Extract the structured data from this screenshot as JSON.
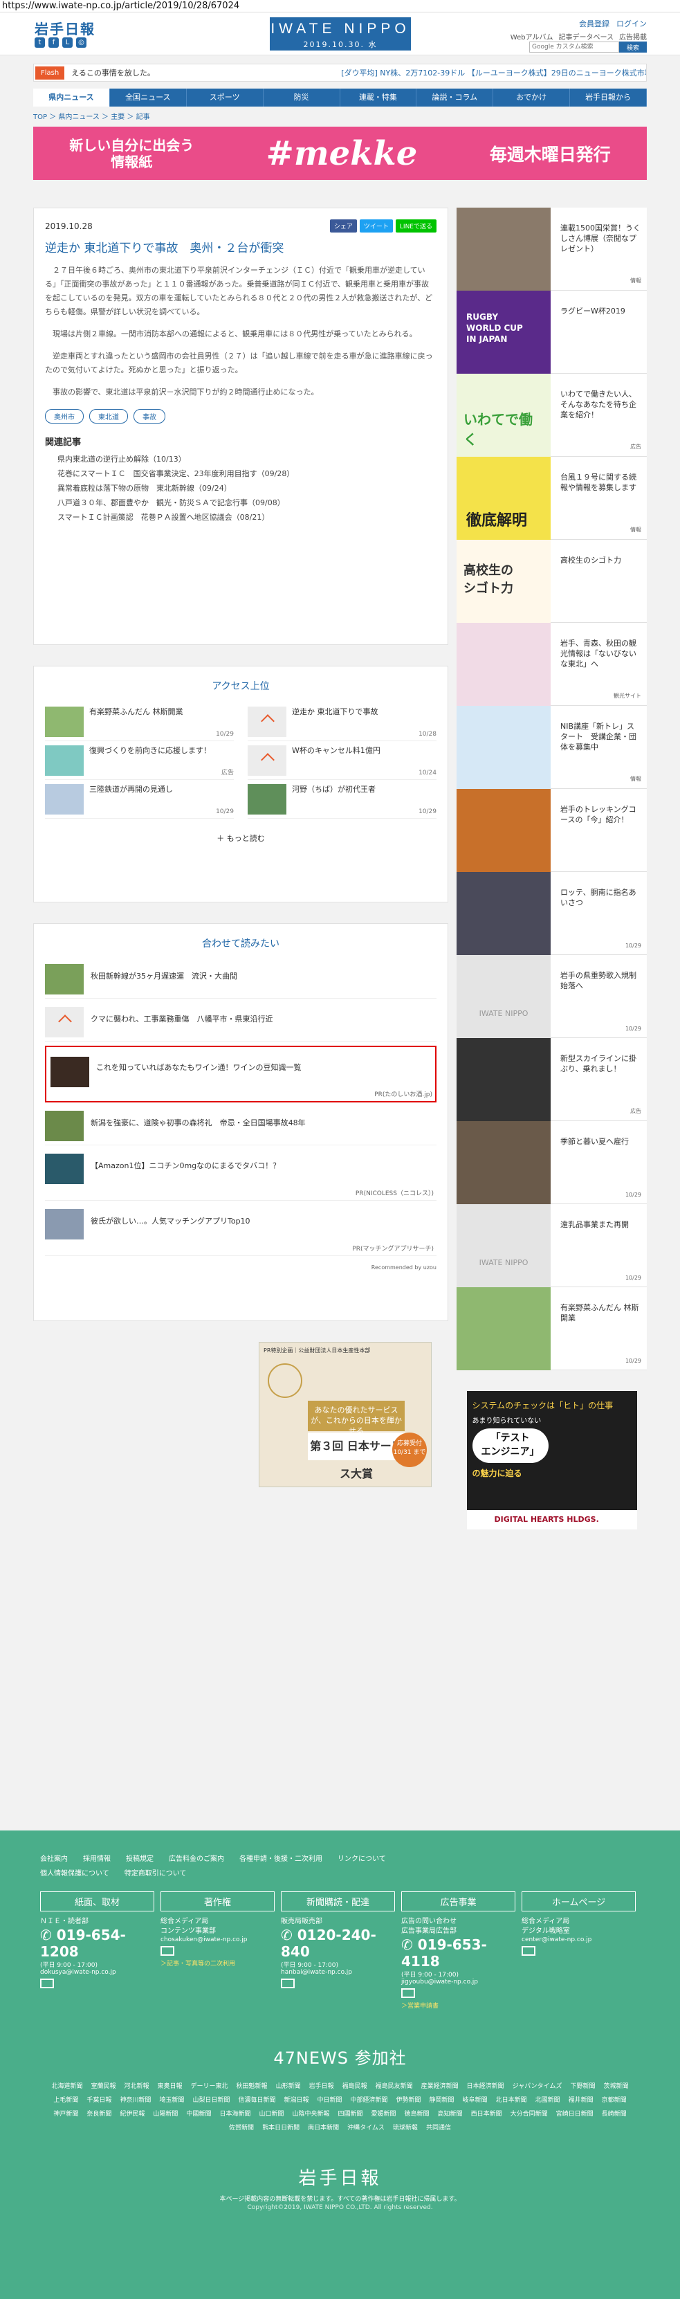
{
  "url": "https://www.iwate-np.co.jp/article/2019/10/28/67024",
  "header": {
    "logo_text": "岩手日報",
    "brand": "IWATE NIPPO",
    "date": "2019.10.30. 水",
    "links": [
      "会員登録",
      "ログイン"
    ],
    "sublinks": [
      "Webアルバム",
      "記事データベース",
      "広告掲載"
    ],
    "search_placeholder": "Google カスタム検索",
    "search_button": "検索",
    "social_icons": [
      "twitter-icon",
      "facebook-icon",
      "line-icon",
      "instagram-icon"
    ]
  },
  "ticker": {
    "label": "Flash",
    "text": "えるこの事情を放した。",
    "market": "[ダウ平均] NY株、2万7102-39ドル  【ルーユーヨーク株式】29日のニューヨーク株式市場のダウ工業株30種"
  },
  "nav": [
    "県内ニュース",
    "全国ニュース",
    "スポーツ",
    "防災",
    "連載・特集",
    "論説・コラム",
    "おでかけ",
    "岩手日報から"
  ],
  "breadcrumb": "TOP ＞ 県内ニュース ＞ 主要 ＞ 記事",
  "banner": {
    "left": "新しい自分に出会う\n情報紙",
    "middle": "#mekke",
    "right": "毎週木曜日発行"
  },
  "article": {
    "date": "2019.10.28",
    "share": [
      "シェア",
      "ツイート",
      "LINEで送る"
    ],
    "title": "逆走か 東北道下りで事故　奥州・２台が衝突",
    "paragraphs": [
      "２７日午後６時ごろ、奥州市の東北道下り平泉前沢インターチェンジ（ＩＣ）付近で「観乗用車が逆走している」「正面衝突の事故があった」と１１０番通報があった。乗普乗道路が同ＩＣ付近で、観乗用車と乗用車が事故を起こしているのを発見。双方の車を運転していたとみられる８０代と２０代の男性２人が救急搬送されたが、どちらも軽傷。県警が詳しい状況を調べている。",
      "現場は片側２車線。一関市消防本部への通報によると、観乗用車には８０代男性が乗っていたとみられる。",
      "逆走車両とすれ違ったという盛岡市の会社員男性（２７）は「追い越し車線で前を走る車が急に進路車線に戻ったので気付いてよけた。死ぬかと思った」と振り返った。",
      "事故の影響で、東北道は平泉前沢－水沢間下りが約２時間通行止めになった。"
    ],
    "tags": [
      "奥州市",
      "東北道",
      "事故"
    ],
    "related_heading": "関連記事",
    "related": [
      "県内東北道の逆行止め解除（10/13）",
      "花巻にスマートＩＣ　国交省事業決定、23年度利用目指す（09/28）",
      "異常着底粒は落下物の原物　東北新幹線（09/24）",
      "八戸道３０年、郡面豊やか　観光・防災ＳＡで記念行事（09/08）",
      "スマートＩＣ計画策認　花巻ＰＡ設置へ地区協議会（08/21）"
    ]
  },
  "ranking": {
    "title": "アクセス上位",
    "items": [
      {
        "text": "有楽野菜ふんだん 林斯開業",
        "date": "10/29"
      },
      {
        "text": "逆走か 東北道下りで事故",
        "date": "10/28"
      },
      {
        "text": "復興づくりを前向きに応援します！",
        "date": "広告"
      },
      {
        "text": "W杯のキャンセル料1億円",
        "date": "10/24"
      },
      {
        "text": "三陸鉄道が再開の見通し",
        "date": "10/29"
      },
      {
        "text": "河野（ちば）が初代王者",
        "date": "10/29"
      }
    ],
    "more": "もっと読む"
  },
  "recommend": {
    "title": "合わせて読みたい",
    "items": [
      {
        "text": "秋田新幹線が35ヶ月遅速運　流沢・大曲間",
        "src": ""
      },
      {
        "text": "クマに襲われ、工事業務重傷　八幡平市・県東沿行近",
        "src": ""
      },
      {
        "text": "これを知っていればあなたもワイン通！ワインの豆知識一覧",
        "src": "PR(たのしいお酒.jp)"
      },
      {
        "text": "新潟を強豪に、道険ゃ初事の森将礼　帝忌・全日国場事故48年",
        "src": ""
      },
      {
        "text": "【Amazon1位】ニコチン0mgなのにまるでタバコ！？",
        "src": "PR(NICOLESS（ニコレス）)"
      },
      {
        "text": "彼氏が欲しい…。人気マッチングアプリTop10",
        "src": "PR(マッチングアプリサーチ)"
      }
    ],
    "recommended_by": "Recommended by uzou"
  },
  "ad_center": {
    "label": "PR特別企画｜公益財団法人日本生産性本部",
    "mid": "あなたの優れたサービスが、これからの日本を輝かせる",
    "award": "第３回 日本サービス大賞",
    "deadline": "応募受付 10/31 まで"
  },
  "sidebar": [
    {
      "text": "連載1500国栄賞！うくしさん博展（奈閲なプレゼント）",
      "src": "情報"
    },
    {
      "text": "ラグビーW杯2019",
      "src": ""
    },
    {
      "text": "いわてで働きたい人、そんなあなたを待ち企業を紹介！",
      "src": "広告"
    },
    {
      "text": "台風１９号に関する続報や情報を募集します",
      "src": "情報"
    },
    {
      "text": "高校生のシゴト力",
      "src": ""
    },
    {
      "text": "岩手、青森、秋田の観光情報は「ないびないな東北」へ",
      "src": "観光サイト"
    },
    {
      "text": "NIB講座「新トレ」スタート　受講企業・団体を募集中",
      "src": "情報"
    },
    {
      "text": "岩手のトレッキングコースの「今」紹介！",
      "src": ""
    },
    {
      "text": "ロッテ、胴南に指名あいさつ",
      "src": "10/29"
    },
    {
      "text": "岩手の県重勢歌入規制始落へ",
      "src": "10/29"
    },
    {
      "text": "新型スカイラインに掛ぶり、乗れまし！",
      "src": "広告"
    },
    {
      "text": "季節と暮い夏へ雇行",
      "src": "10/29"
    },
    {
      "text": "遠乳品事業また再開",
      "src": "10/29"
    },
    {
      "text": "有楽野菜ふんだん 林斯開業",
      "src": "10/29"
    }
  ],
  "side_ad": {
    "top": "システムのチェックは「ヒト」の仕事",
    "sub": "あまり知られていない",
    "pill": "「テスト\nエンジニア」",
    "bottom": "の魅力に迫る",
    "company": "DIGITAL HEARTS HLDGS."
  },
  "footer": {
    "links": [
      "会社案内",
      "採用情報",
      "投稿規定",
      "広告料金のご案内",
      "各種申請・後援・二次利用",
      "リンクについて",
      "個人情報保護について",
      "特定商取引について"
    ],
    "columns": [
      {
        "heading": "紙面、取材",
        "l1": "ＮＩＥ・読者部",
        "phone": "019-654-1208",
        "hours": "(平日 9:00 - 17:00)",
        "mail": "dokusya@iwate-np.co.jp",
        "extra": ""
      },
      {
        "heading": "著作権",
        "l1": "総合メディア局\nコンテンツ事業部",
        "phone": "",
        "hours": "",
        "mail": "chosakuken@iwate-np.co.jp",
        "extra": "＞記事・写真等の二次利用"
      },
      {
        "heading": "新聞購読・配達",
        "l1": "販売局販売部",
        "phone": "0120-240-840",
        "hours": "(平日 9:00 - 17:00)",
        "mail": "hanbai@iwate-np.co.jp",
        "extra": ""
      },
      {
        "heading": "広告事業",
        "l1": "広告の問い合わせ\n広告事業局広告部",
        "phone": "019-653-4118",
        "hours": "(平日 9:00 - 17:00)",
        "mail": "jigyoubu@iwate-np.co.jp",
        "extra": "＞営業申請書"
      },
      {
        "heading": "ホームページ",
        "l1": "総合メディア局\nデジタル戦略室",
        "phone": "",
        "hours": "",
        "mail": "center@iwate-np.co.jp",
        "extra": ""
      }
    ],
    "n47_title": "47NEWS 参加社",
    "papers": [
      "北海道新聞",
      "室蘭民報",
      "河北新報",
      "東奥日報",
      "デーリー東北",
      "秋田魁新報",
      "山形新聞",
      "岩手日報",
      "福島民報",
      "福島民友新聞",
      "産業経済新聞",
      "日本経済新聞",
      "ジャパンタイムズ",
      "下野新聞",
      "茨城新聞",
      "上毛新聞",
      "千葉日報",
      "神奈川新聞",
      "埼玉新聞",
      "山梨日日新聞",
      "信濃毎日新聞",
      "新潟日報",
      "中日新聞",
      "中部経済新聞",
      "伊勢新聞",
      "静岡新聞",
      "岐阜新聞",
      "北日本新聞",
      "北國新聞",
      "福井新聞",
      "京都新聞",
      "神戸新聞",
      "奈良新聞",
      "紀伊民報",
      "山陽新聞",
      "中國新聞",
      "日本海新聞",
      "山口新聞",
      "山陰中央新報",
      "四國新聞",
      "愛媛新聞",
      "徳島新聞",
      "高知新聞",
      "西日本新聞",
      "大分合同新聞",
      "宮崎日日新聞",
      "長崎新聞",
      "佐賀新聞",
      "熊本日日新聞",
      "南日本新聞",
      "沖縄タイムス",
      "琉球新報",
      "共同通信"
    ],
    "logo": "岩手日報",
    "note": "本ページ掲載内容の無断転載を禁じます。すべての著作権は岩手日報社に帰属します。",
    "copyright": "Copyright©2019, IWATE NIPPO CO.,LTD. All rights reserved."
  },
  "colors": {
    "brand": "#2469a8",
    "flash": "#e85a2c",
    "banner": "#ea4c89",
    "footer": "#4aae8a",
    "highlight": "#e00000"
  }
}
